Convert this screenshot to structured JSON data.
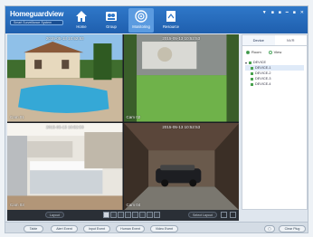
{
  "app": {
    "title": "Homeguardview",
    "subtitle": "Smart Surveillance System"
  },
  "nav": [
    {
      "label": "Home",
      "icon": "home-icon"
    },
    {
      "label": "Group",
      "icon": "group-icon"
    },
    {
      "label": "Monitoring",
      "icon": "camera-icon"
    },
    {
      "label": "Resource",
      "icon": "resource-icon"
    }
  ],
  "window_buttons": [
    "▼",
    "■",
    "■",
    "━",
    "■",
    "✕"
  ],
  "cameras": [
    {
      "timestamp": "2015-05-13 10:52:53",
      "label": "Cam 01"
    },
    {
      "timestamp": "2015-05-13 10:52:53",
      "label": "Cam 02"
    },
    {
      "timestamp": "2015-05-13 10:52:53",
      "label": "Cam 03"
    },
    {
      "timestamp": "2015-05-13 10:52:53",
      "label": "Cam 04"
    }
  ],
  "panel": {
    "tabs": [
      "Device",
      "NVR"
    ],
    "radios": [
      "Room",
      "View"
    ],
    "tree_root": "DEVICE",
    "tree_items": [
      "DEVICE-1",
      "DEVICE-2",
      "DEVICE-3",
      "DEVICE-4"
    ]
  },
  "controls": {
    "left_pill": "Layout",
    "right_pill": "Select Layout"
  },
  "status": {
    "buttons": [
      "Table",
      "Alert Event",
      "Input Event",
      "Human Event",
      "Video Event"
    ],
    "right_icon_label": "▢",
    "right_button": "Clear Plug"
  }
}
